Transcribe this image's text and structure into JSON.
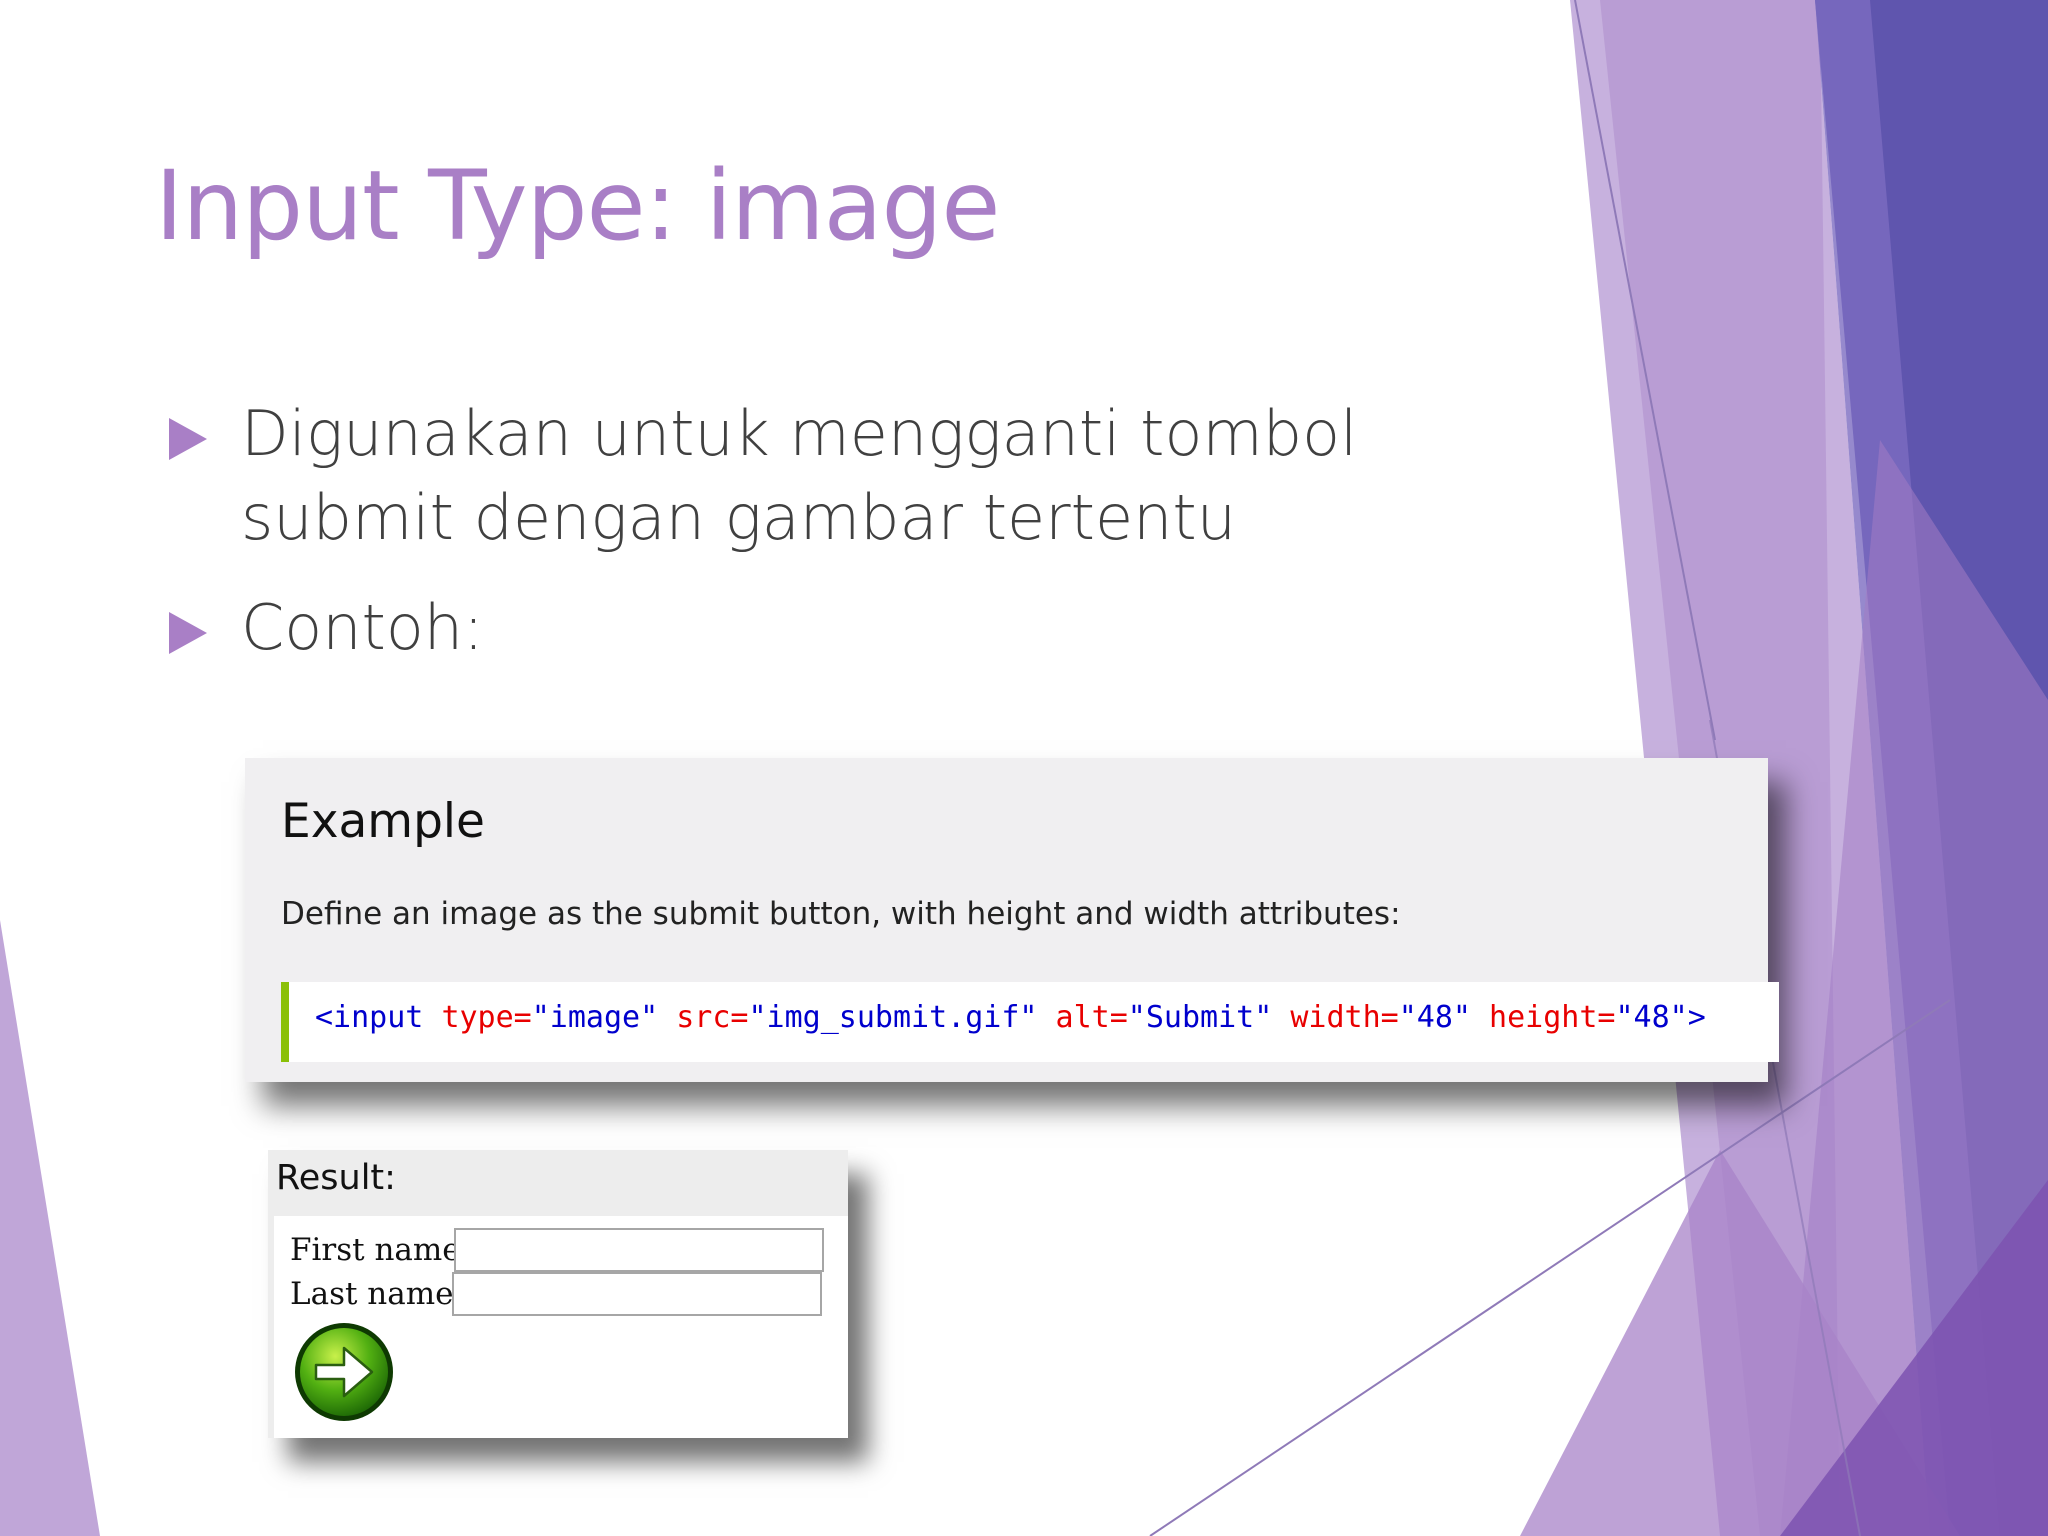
{
  "slide": {
    "title": "Input Type: image",
    "bullets": [
      "Digunakan untuk mengganti tombol submit dengan gambar tertentu",
      "Contoh:"
    ]
  },
  "example": {
    "heading": "Example",
    "description": "Define an image as the submit button, with height and width attributes:",
    "code": {
      "open": "<input ",
      "attr1": "type=",
      "val1": "\"image\"",
      "attr2": "src=",
      "val2": "\"img_submit.gif\"",
      "attr3": "alt=",
      "val3": "\"Submit\"",
      "attr4": "width=",
      "val4": "\"48\"",
      "attr5": "height=",
      "val5": "\"48\"",
      "close": ">"
    },
    "accent_color": "#8ac007"
  },
  "result": {
    "label": "Result:",
    "first_name_label": "First name:",
    "last_name_label": "Last name:",
    "first_name_value": "",
    "last_name_value": "",
    "submit_icon": "green-arrow-submit-icon"
  },
  "theme": {
    "title_color": "#a97fc6",
    "text_color": "#404040",
    "decor_purple_light": "#c0a6d8",
    "decor_purple": "#a883c8",
    "decor_indigo": "#5f55ae"
  }
}
